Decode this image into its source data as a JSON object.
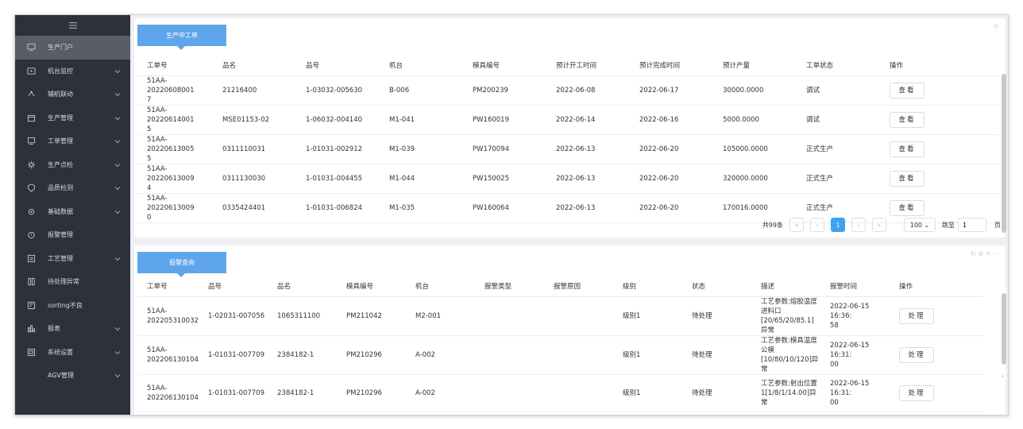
{
  "sidebar": {
    "toggle_icon": "menu-icon",
    "items": [
      {
        "label": "生产门户",
        "icon": "monitor-icon",
        "active": true,
        "chevron": false
      },
      {
        "label": "机台监控",
        "icon": "screen-icon",
        "active": false,
        "chevron": true
      },
      {
        "label": "辅机联动",
        "icon": "link-icon",
        "active": false,
        "chevron": true
      },
      {
        "label": "生产管理",
        "icon": "calendar-icon",
        "active": false,
        "chevron": true
      },
      {
        "label": "工单管理",
        "icon": "desktop-icon",
        "active": false,
        "chevron": true
      },
      {
        "label": "生产点检",
        "icon": "gear-icon",
        "active": false,
        "chevron": true
      },
      {
        "label": "品质检测",
        "icon": "shield-icon",
        "active": false,
        "chevron": true
      },
      {
        "label": "基础数据",
        "icon": "settings-icon",
        "active": false,
        "chevron": true
      },
      {
        "label": "报警管理",
        "icon": "alarm-icon",
        "active": false,
        "chevron": false
      },
      {
        "label": "工艺管理",
        "icon": "process-icon",
        "active": false,
        "chevron": true
      },
      {
        "label": "待处理异常",
        "icon": "exception-icon",
        "active": false,
        "chevron": false
      },
      {
        "label": "sorting不良",
        "icon": "sorting-icon",
        "active": false,
        "chevron": false
      },
      {
        "label": "报表",
        "icon": "bar-chart-icon",
        "active": false,
        "chevron": true
      },
      {
        "label": "系统设置",
        "icon": "system-icon",
        "active": false,
        "chevron": true
      },
      {
        "label": "AGV管理",
        "icon": "agv-icon",
        "active": false,
        "chevron": true
      }
    ]
  },
  "work_orders": {
    "tab_label": "生产中工单",
    "columns": [
      "工单号",
      "品名",
      "品号",
      "机台",
      "模具编号",
      "预计开工时间",
      "预计完成时间",
      "预计产量",
      "工单状态",
      "操作"
    ],
    "rows": [
      {
        "order": "51AA-20220608001",
        "order2": "7",
        "name": "21216400",
        "part": "1-03032-005630",
        "machine": "B-006",
        "mold": "PM200239",
        "start": "2022-06-08",
        "end": "2022-06-17",
        "qty": "30000.0000",
        "status": "调试",
        "action": "查看"
      },
      {
        "order": "51AA-20220614001",
        "order2": "5",
        "name": "MSE01153-02",
        "part": "1-06032-004140",
        "machine": "M1-041",
        "mold": "PW160019",
        "start": "2022-06-14",
        "end": "2022-06-16",
        "qty": "5000.0000",
        "status": "调试",
        "action": "查看"
      },
      {
        "order": "51AA-20220613005",
        "order2": "5",
        "name": "0311110031",
        "part": "1-01031-002912",
        "machine": "M1-039",
        "mold": "PW170094",
        "start": "2022-06-13",
        "end": "2022-06-20",
        "qty": "105000.0000",
        "status": "正式生产",
        "action": "查看"
      },
      {
        "order": "51AA-20220613009",
        "order2": "4",
        "name": "0311130030",
        "part": "1-01031-004455",
        "machine": "M1-044",
        "mold": "PW150025",
        "start": "2022-06-13",
        "end": "2022-06-20",
        "qty": "320000.0000",
        "status": "正式生产",
        "action": "查看"
      },
      {
        "order": "51AA-20220613009",
        "order2": "0",
        "name": "0335424401",
        "part": "1-01031-006824",
        "machine": "M1-035",
        "mold": "PW160064",
        "start": "2022-06-13",
        "end": "2022-06-20",
        "qty": "170016.0000",
        "status": "正式生产",
        "action": "查看"
      }
    ],
    "pagination": {
      "total": "共99条",
      "current": "1",
      "page_size": "100",
      "jump_label": "跳至",
      "jump_value": "1",
      "page_suffix": "页"
    }
  },
  "alarms": {
    "tab_label": "报警查询",
    "columns": [
      "工单号",
      "品号",
      "品名",
      "模具编号",
      "机台",
      "报警类型",
      "报警原因",
      "级别",
      "状态",
      "描述",
      "报警时间",
      "操作"
    ],
    "rows": [
      {
        "order": "51AA-",
        "order2": "202205310032",
        "part": "1-02031-007056",
        "name": "1065311100",
        "mold": "PM211042",
        "machine": "M2-001",
        "type": "",
        "reason": "",
        "level": "级别1",
        "status": "待处理",
        "desc": "工艺参数:熔胶温度进料口[20/65/20/85.1]异常",
        "time": "2022-06-15 16:36:",
        "time2": "58",
        "action": "处理"
      },
      {
        "order": "51AA-",
        "order2": "202206130104",
        "part": "1-01031-007709",
        "name": "2384182-1",
        "mold": "PM210296",
        "machine": "A-002",
        "type": "",
        "reason": "",
        "level": "级别1",
        "status": "待处理",
        "desc": "工艺参数:模具温度公模[10/80/10/120]异常",
        "time": "2022-06-15 16:31:",
        "time2": "00",
        "action": "处理"
      },
      {
        "order": "51AA-",
        "order2": "202206130104",
        "part": "1-01031-007709",
        "name": "2384182-1",
        "mold": "PM210296",
        "machine": "A-002",
        "type": "",
        "reason": "",
        "level": "级别1",
        "status": "待处理",
        "desc": "工艺参数:射出位置1[1/8/1/14.00]异常",
        "time": "2022-06-15 16:31:",
        "time2": "00",
        "action": "处理"
      }
    ]
  }
}
